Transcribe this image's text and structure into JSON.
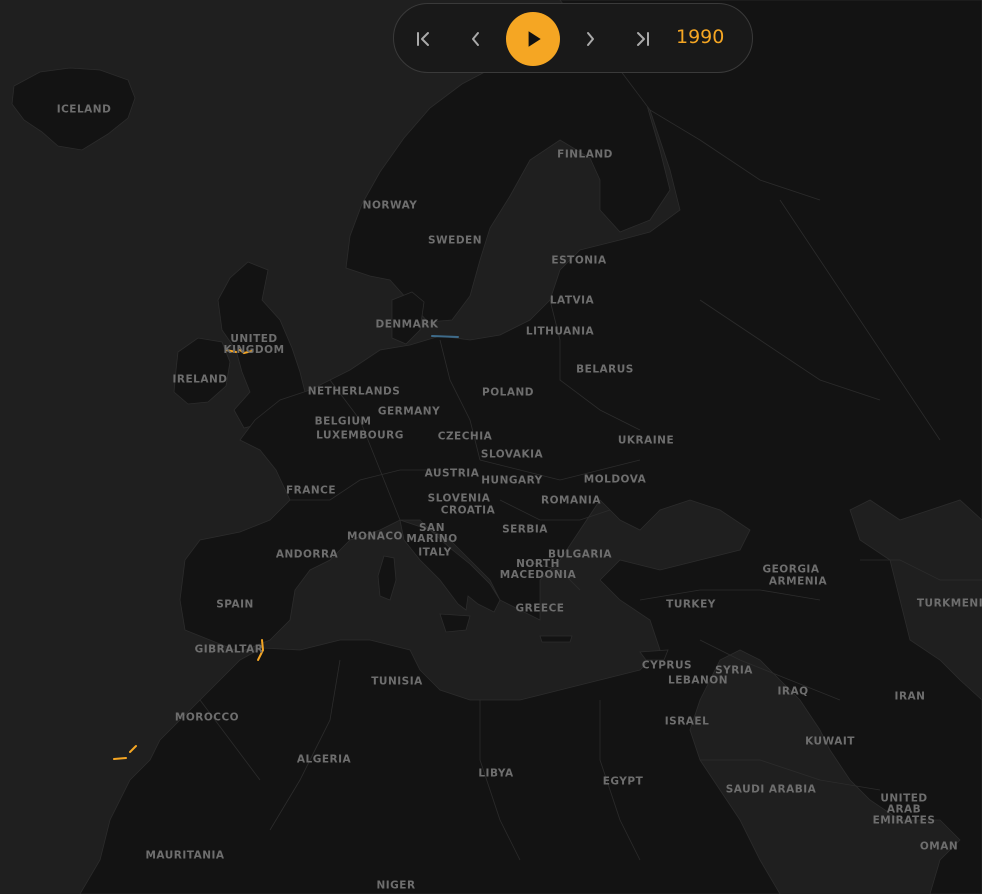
{
  "colors": {
    "sea": "#1f1f1f",
    "land": "#131313",
    "border": "#2c2c2c",
    "label": "#6e6e6e",
    "accent": "#f5a623",
    "line_blue": "#3e6b8a"
  },
  "player": {
    "first_icon": "skip-first-icon",
    "prev_icon": "chevron-left-icon",
    "play_icon": "play-icon",
    "next_icon": "chevron-right-icon",
    "last_icon": "skip-last-icon",
    "year": "1990"
  },
  "labels": {
    "iceland": "ICELAND",
    "finland": "FINLAND",
    "norway": "NORWAY",
    "sweden": "SWEDEN",
    "estonia": "ESTONIA",
    "latvia": "LATVIA",
    "lithuania": "LITHUANIA",
    "denmark": "DENMARK",
    "united_kingdom": "UNITED\nKINGDOM",
    "ireland": "IRELAND",
    "belarus": "BELARUS",
    "netherlands": "NETHERLANDS",
    "poland": "POLAND",
    "germany": "GERMANY",
    "belgium": "BELGIUM",
    "luxembourg": "LUXEMBOURG",
    "czechia": "CZECHIA",
    "ukraine": "UKRAINE",
    "slovakia": "SLOVAKIA",
    "austria": "AUSTRIA",
    "moldova": "MOLDOVA",
    "hungary": "HUNGARY",
    "france": "FRANCE",
    "slovenia": "SLOVENIA",
    "croatia": "CROATIA",
    "romania": "ROMANIA",
    "san_marino": "SAN\nMARINO",
    "serbia": "SERBIA",
    "monaco": "MONACO",
    "andorra": "ANDORRA",
    "italy": "ITALY",
    "bulgaria": "BULGARIA",
    "north_macedonia": "NORTH\nMACEDONIA",
    "georgia": "GEORGIA",
    "armenia": "ARMENIA",
    "spain": "SPAIN",
    "turkey": "TURKEY",
    "greece": "GREECE",
    "turkmenistan": "TURKMENI",
    "gibraltar": "GIBRALTAR",
    "cyprus": "CYPRUS",
    "syria": "SYRIA",
    "lebanon": "LEBANON",
    "tunisia": "TUNISIA",
    "iraq": "IRAQ",
    "iran": "IRAN",
    "morocco": "MOROCCO",
    "israel": "ISRAEL",
    "kuwait": "KUWAIT",
    "algeria": "ALGERIA",
    "libya": "LIBYA",
    "egypt": "EGYPT",
    "saudi_arabia": "SAUDI ARABIA",
    "uae": "UNITED\nARAB\nEMIRATES",
    "oman": "OMAN",
    "mauritania": "MAURITANIA",
    "niger": "NIGER"
  }
}
